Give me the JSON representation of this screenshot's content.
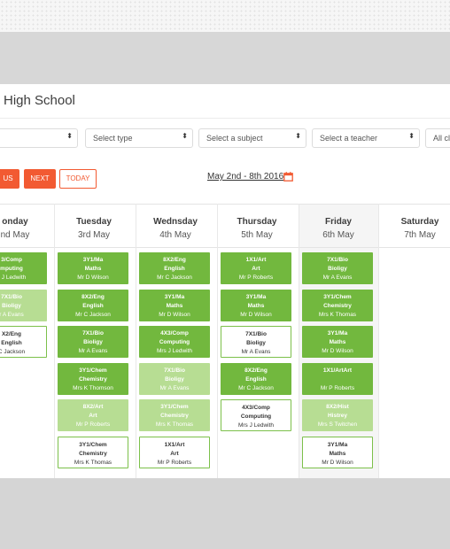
{
  "title": "High School",
  "filters": [
    {
      "label": ""
    },
    {
      "label": "Select type"
    },
    {
      "label": "Select a subject"
    },
    {
      "label": "Select a teacher"
    },
    {
      "label": "All cla"
    }
  ],
  "buttons": {
    "previous": "US",
    "next": "NEXT",
    "today": "TODAY"
  },
  "date_range": "May 2nd - 8th 2016",
  "days": [
    {
      "name": "onday",
      "date": "nd May"
    },
    {
      "name": "Tuesday",
      "date": "3rd May"
    },
    {
      "name": "Wednsday",
      "date": "4th May"
    },
    {
      "name": "Thursday",
      "date": "5th May"
    },
    {
      "name": "Friday",
      "date": "6th May"
    },
    {
      "name": "Saturday",
      "date": "7th May"
    }
  ],
  "lessons": [
    [
      {
        "l1": "3/Comp",
        "l2": "mputing",
        "l3": "s J Ledwith",
        "style": "dark"
      },
      {
        "l1": "7X1/Bio",
        "l2": "Bioligy",
        "l3": "r A Evans",
        "style": "light"
      },
      {
        "l1": "X2/Eng",
        "l2": "English",
        "l3": "C Jackson",
        "style": "outline"
      }
    ],
    [
      {
        "l1": "3Y1/Ma",
        "l2": "Maths",
        "l3": "Mr D Wilson",
        "style": "dark"
      },
      {
        "l1": "8X2/Eng",
        "l2": "English",
        "l3": "Mr C Jackson",
        "style": "dark"
      },
      {
        "l1": "7X1/Bio",
        "l2": "Bioligy",
        "l3": "Mr A Evans",
        "style": "dark"
      },
      {
        "l1": "3Y1/Chem",
        "l2": "Chemistry",
        "l3": "Mrs K Thomson",
        "style": "dark"
      },
      {
        "l1": "8X2/Art",
        "l2": "Art",
        "l3": "Mr P Roberts",
        "style": "light"
      },
      {
        "l1": "3Y1/Chem",
        "l2": "Chemistry",
        "l3": "Mrs K Thomas",
        "style": "outline"
      }
    ],
    [
      {
        "l1": "8X2/Eng",
        "l2": "English",
        "l3": "Mr C Jackson",
        "style": "dark"
      },
      {
        "l1": "3Y1/Ma",
        "l2": "Maths",
        "l3": "Mr D Wilson",
        "style": "dark"
      },
      {
        "l1": "4X3/Comp",
        "l2": "Computing",
        "l3": "Mrs J Ledwith",
        "style": "dark"
      },
      {
        "l1": "7X1/Bio",
        "l2": "Bioligy",
        "l3": "Mr A Evans",
        "style": "light"
      },
      {
        "l1": "3Y1/Chem",
        "l2": "Chemistry",
        "l3": "Mrs K Thomas",
        "style": "light"
      },
      {
        "l1": "1X1/Art",
        "l2": "Art",
        "l3": "Mr P Roberts",
        "style": "outline"
      }
    ],
    [
      {
        "l1": "1X1/Art",
        "l2": "Art",
        "l3": "Mr P Roberts",
        "style": "dark"
      },
      {
        "l1": "3Y1/Ma",
        "l2": "Maths",
        "l3": "Mr D Wilson",
        "style": "dark"
      },
      {
        "l1": "7X1/Bio",
        "l2": "Bioligy",
        "l3": "Mr A Evans",
        "style": "outline"
      },
      {
        "l1": "8X2/Eng",
        "l2": "English",
        "l3": "Mr C Jackson",
        "style": "dark"
      },
      {
        "l1": "4X3/Comp",
        "l2": "Computing",
        "l3": "Mrs J Ledwith",
        "style": "outline"
      }
    ],
    [
      {
        "l1": "7X1/Bio",
        "l2": "Bioligy",
        "l3": "Mr A Evans",
        "style": "dark"
      },
      {
        "l1": "3Y1/Chem",
        "l2": "Chemistry",
        "l3": "Mrs K Thomas",
        "style": "dark"
      },
      {
        "l1": "3Y1/Ma",
        "l2": "Maths",
        "l3": "Mr D Wilson",
        "style": "dark"
      },
      {
        "l1": "1X1/ArtArt",
        "l2": "",
        "l3": "Mr P Roberts",
        "style": "dark"
      },
      {
        "l1": "8X2/Hist",
        "l2": "Histrey",
        "l3": "Mrs S Twitchen",
        "style": "light"
      },
      {
        "l1": "3Y1/Ma",
        "l2": "Maths",
        "l3": "Mr D Wilson",
        "style": "outline"
      }
    ]
  ],
  "colors": {
    "accent": "#f25a32",
    "lesson_dark": "#72b83e",
    "lesson_light": "#b7dd93"
  },
  "icons": {
    "calendar": "calendar-icon",
    "select_arrow": "up-down-arrow-icon"
  }
}
